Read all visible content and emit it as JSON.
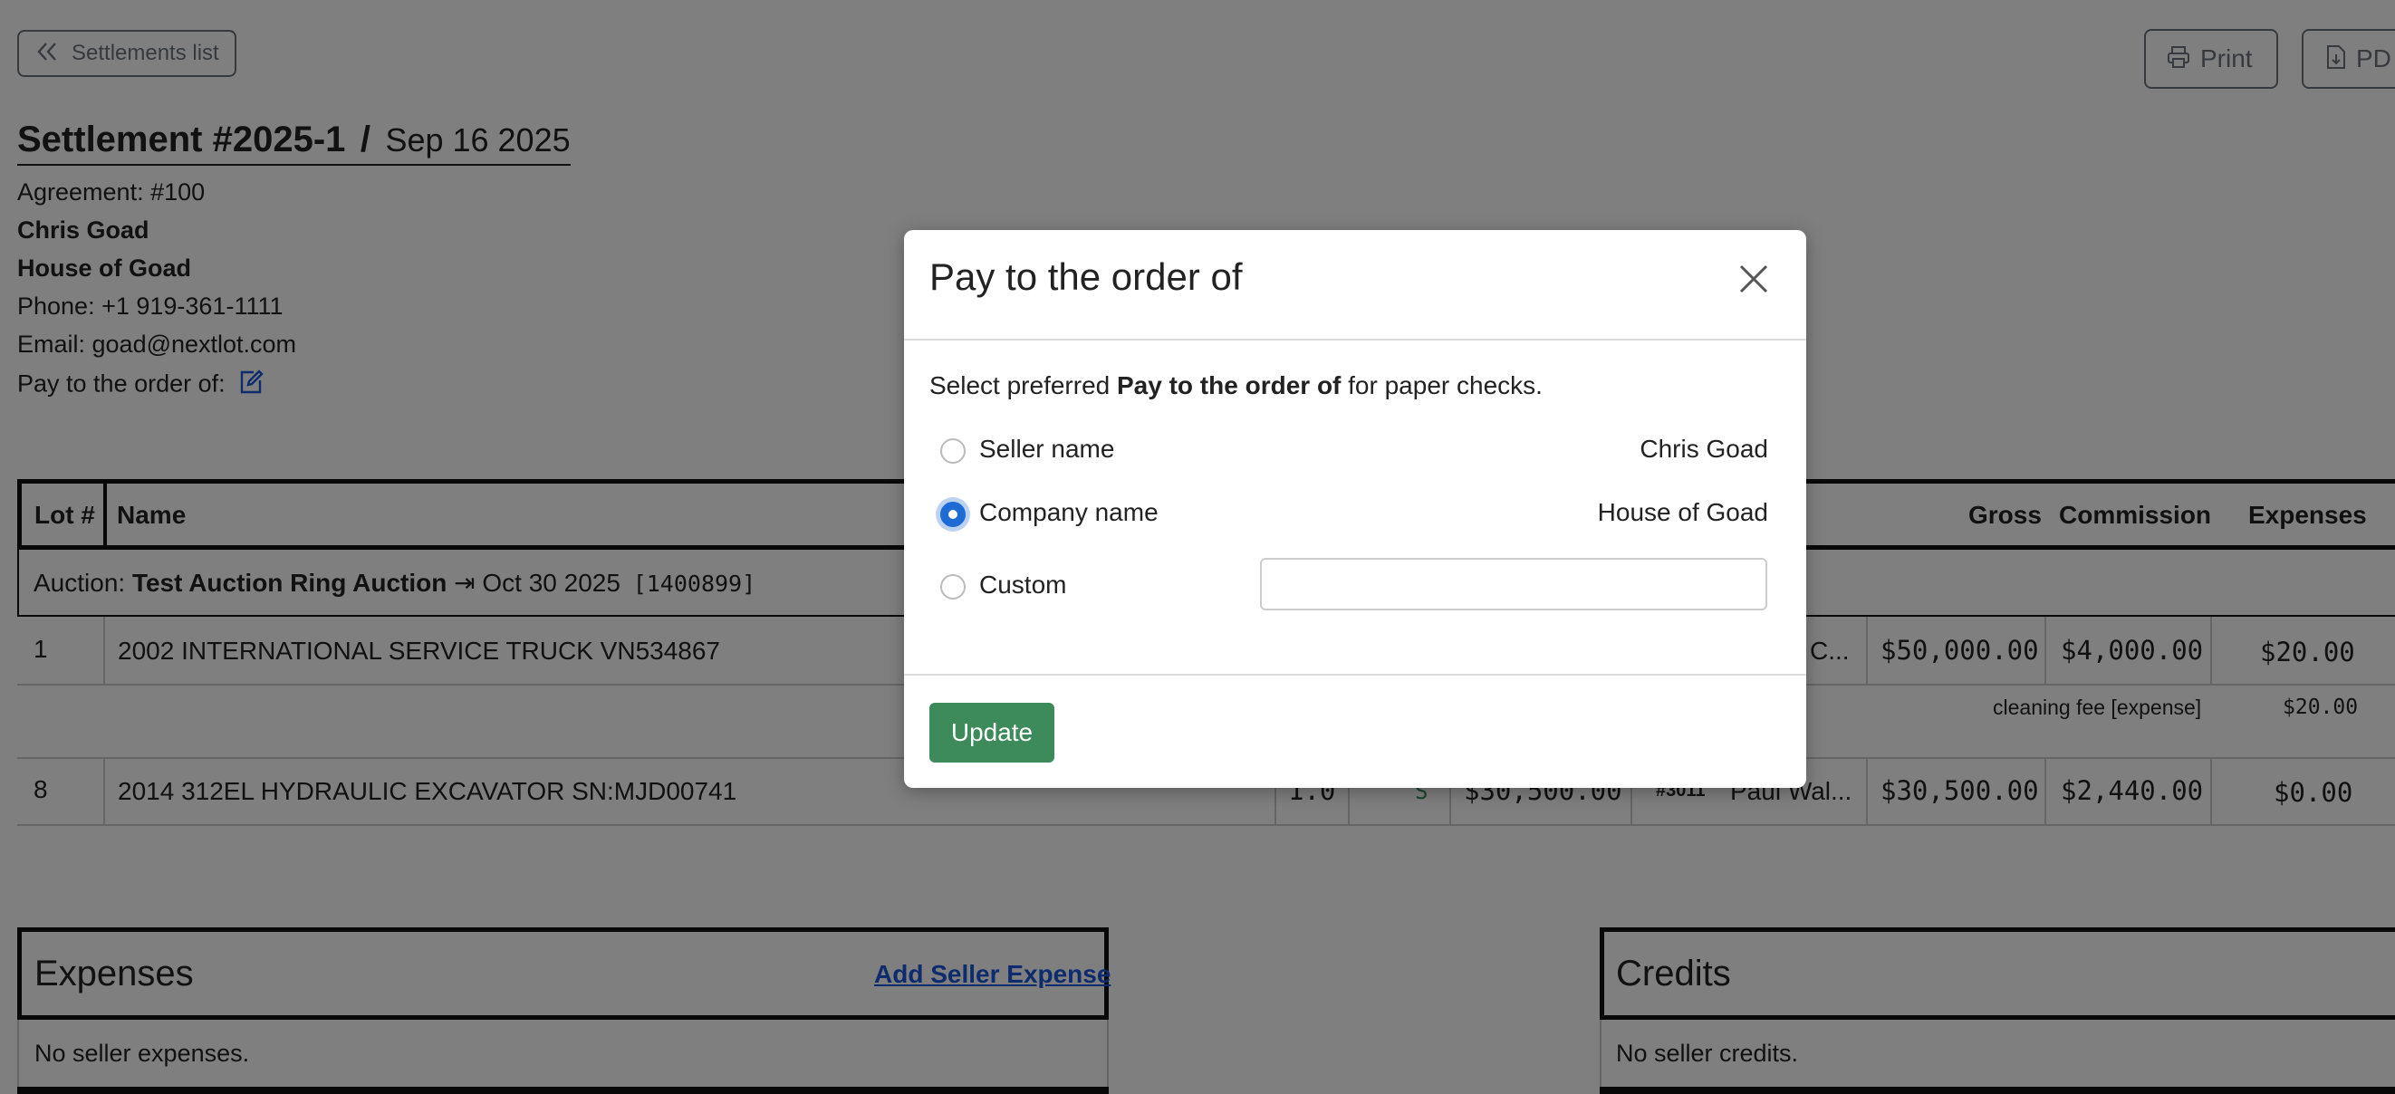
{
  "toolbar": {
    "back_label": "Settlements list",
    "print_label": "Print",
    "pdf_label": "PD"
  },
  "header": {
    "title": "Settlement #2025-1",
    "separator": "/",
    "date": "Sep 16 2025"
  },
  "seller": {
    "agreement": "Agreement: #100",
    "name": "Chris Goad",
    "company": "House of Goad",
    "phone": "Phone: +1 919-361-1111",
    "email": "Email: goad@nextlot.com",
    "pay_to_label": "Pay to the order of:"
  },
  "lots_table": {
    "headers": {
      "lot": "Lot #",
      "name": "Name",
      "gross": "Gross",
      "commission": "Commission",
      "expenses": "Expenses"
    },
    "auction_row": {
      "prefix": "Auction:",
      "name": "Test Auction Ring Auction",
      "arrow": "⇥",
      "date": "Oct 30 2025",
      "code": "[1400899]"
    },
    "rows": [
      {
        "lot": "1",
        "name": "2002 INTERNATIONAL SERVICE TRUCK VN534867",
        "buyer": "C...",
        "gross": "$50,000.00",
        "commission": "$4,000.00",
        "expenses": "$20.00"
      },
      {
        "lot": "8",
        "name": "2014 312EL HYDRAULIC EXCAVATOR SN:MJD00741",
        "qty": "1.0",
        "status": "S",
        "price": "$30,500.00",
        "buyer_num": "#3011",
        "buyer": "Paul Wal...",
        "gross": "$30,500.00",
        "commission": "$2,440.00",
        "expenses": "$0.00"
      }
    ],
    "expense_detail": {
      "label": "cleaning fee [expense]",
      "amount": "$20.00"
    }
  },
  "expenses_panel": {
    "title": "Expenses",
    "add_link": "Add Seller Expense",
    "empty": "No seller expenses."
  },
  "credits_panel": {
    "title": "Credits",
    "empty": "No seller credits."
  },
  "modal": {
    "title": "Pay to the order of",
    "instruction_prefix": "Select preferred ",
    "instruction_bold": "Pay to the order of",
    "instruction_suffix": " for paper checks.",
    "options": [
      {
        "label": "Seller name",
        "value": "Chris Goad",
        "selected": false
      },
      {
        "label": "Company name",
        "value": "House of Goad",
        "selected": true
      },
      {
        "label": "Custom",
        "value": "",
        "selected": false
      }
    ],
    "custom_value": "",
    "update_label": "Update"
  },
  "colors": {
    "overlay": "#000000",
    "update_button": "#3d8a5a",
    "link": "#1a56db",
    "radio_selected": "#1e6bd6",
    "status_s": "#3d8a5a"
  }
}
